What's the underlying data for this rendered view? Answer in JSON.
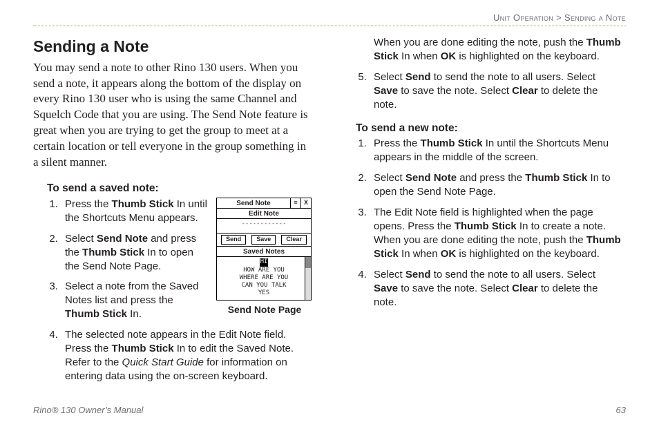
{
  "breadcrumb": {
    "section": "Unit Operation",
    "page": "Sending a Note"
  },
  "h1": "Sending a Note",
  "intro": "You may send a note to other Rino 130 users. When you send a note, it appears along the bottom of the display on every Rino 130 user who is using the same Channel and Squelch Code that you are using. The Send Note feature is great when you are trying to get the group to meet at a certain location or tell everyone in the group something in a silent manner.",
  "saved": {
    "heading": "To send a saved note:",
    "s1a": "Press the ",
    "s1b": "Thumb Stick",
    "s1c": " In until the Shortcuts Menu appears.",
    "s2a": "Select ",
    "s2b": "Send Note",
    "s2c": " and press the ",
    "s2d": "Thumb Stick",
    "s2e": " In to open the Send Note Page.",
    "s3a": "Select a note from the Saved Notes list and press the ",
    "s3b": "Thumb Stick",
    "s3c": " In.",
    "s4a": "The selected note appears in the Edit Note field. Press the ",
    "s4b": "Thumb Stick",
    "s4c": " In to edit the Saved Note. Refer to the ",
    "s4d": "Quick Start Guide",
    "s4e": " for information on entering data using the on-screen keyboard.",
    "s4f": "When you are done editing the note, push the ",
    "s4g": "Thumb Stick",
    "s4h": " In when ",
    "s4i": "OK",
    "s4j": " is highlighted on the keyboard.",
    "s5a": "Select ",
    "s5b": "Send",
    "s5c": " to send the note to all users. Select ",
    "s5d": "Save",
    "s5e": " to save the note. Select ",
    "s5f": "Clear",
    "s5g": " to delete the note."
  },
  "newnote": {
    "heading": "To send a new note:",
    "n1a": "Press the ",
    "n1b": "Thumb Stick",
    "n1c": " In until the Shortcuts Menu appears in the middle of the screen.",
    "n2a": "Select ",
    "n2b": "Send Note",
    "n2c": " and press the ",
    "n2d": "Thumb Stick",
    "n2e": " In to open the Send Note Page.",
    "n3a": "The Edit Note field is highlighted when the page opens. Press the ",
    "n3b": "Thumb Stick",
    "n3c": " In to create a note. When you are done editing the note, push the ",
    "n3d": "Thumb Stick",
    "n3e": " In when ",
    "n3f": "OK",
    "n3g": " is highlighted on the keyboard.",
    "n4a": "Select ",
    "n4b": "Send",
    "n4c": " to send the note to all users. Select ",
    "n4d": "Save",
    "n4e": " to save the note. Select ",
    "n4f": "Clear",
    "n4g": " to delete the note."
  },
  "figure": {
    "caption": "Send Note Page",
    "title": "Send Note",
    "menuGlyph": "≡",
    "closeGlyph": "X",
    "editLabel": "Edit Note",
    "editDashes": "------------",
    "btnSend": "Send",
    "btnSave": "Save",
    "btnClear": "Clear",
    "savedLabel": "Saved Notes",
    "line1": "HI",
    "line2": "HOW ARE YOU",
    "line3": "WHERE ARE YOU",
    "line4": "CAN YOU TALK",
    "line5": "YES"
  },
  "footer": {
    "manual": "Rino® 130 Owner’s Manual",
    "pageNo": "63"
  }
}
